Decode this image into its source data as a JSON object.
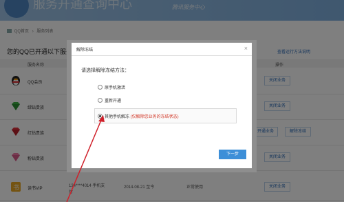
{
  "banner": {
    "title": "服务开通查询中心",
    "slogan": "腾讯服务中心"
  },
  "breadcrumb": {
    "home": "QQ首页",
    "current": "服务列表"
  },
  "page": {
    "heading": "您的QQ已开通以下服务",
    "guide_link": "查看运行方法说明"
  },
  "table": {
    "headers": {
      "name": "服务名称",
      "action": "操作"
    },
    "rows": [
      {
        "name": "QQ会员",
        "button": "关闭业务"
      },
      {
        "name": "绿钻贵族",
        "button": "关闭业务"
      },
      {
        "name": "红钻贵族",
        "button_left": "开通业务",
        "button_right": "解除冻结"
      },
      {
        "name": "粉钻贵族",
        "button": "关闭业务"
      },
      {
        "name": "读书VIP",
        "phone": "134****4014 手机支付",
        "date": "2014-08-21 至今",
        "status": "正常使用",
        "button": "关闭业务"
      }
    ]
  },
  "dialog": {
    "title": "解除冻结",
    "close": "×",
    "prompt": "请选择解除冻结方法：",
    "options": [
      {
        "label": "原手机激活",
        "selected": false
      },
      {
        "label": "重新开通",
        "selected": false
      },
      {
        "label": "其他手机解冻",
        "note": "(仅解除您业务的冻结状态)",
        "selected": true
      }
    ],
    "next_button": "下一步"
  },
  "colors": {
    "accent": "#3d8fd8",
    "warning": "#d23a2a",
    "arrow": "#d0202a"
  }
}
